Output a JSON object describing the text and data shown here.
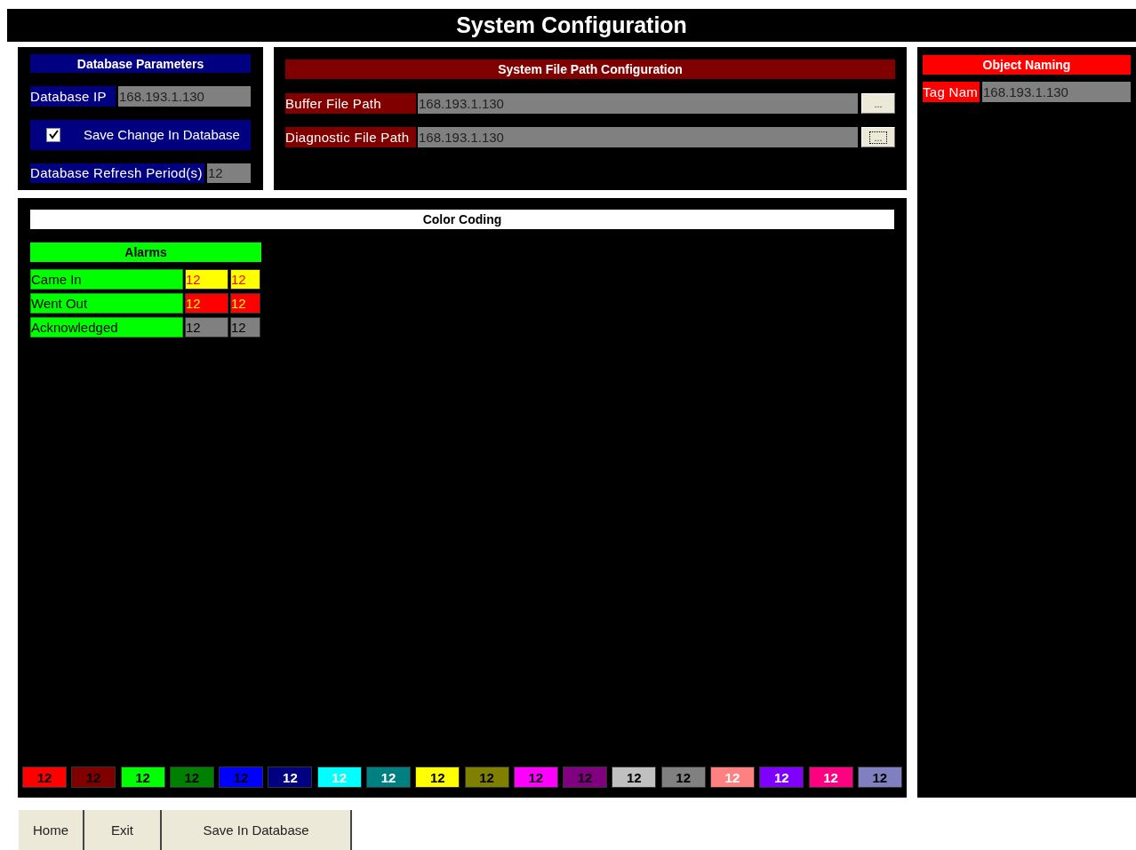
{
  "window": {
    "title": "System Configuration"
  },
  "database_parameters": {
    "title": "Database Parameters",
    "ip_label": "Database IP",
    "ip_value": "168.193.1.130",
    "save_change": {
      "label": "Save Change In Database",
      "checked": true
    },
    "refresh_label": "Database Refresh Period(s)",
    "refresh_value": "12"
  },
  "file_paths": {
    "title": "System File Path Configuration",
    "rows": [
      {
        "label": "Buffer File Path",
        "value": "168.193.1.130",
        "button": "...",
        "focused": false
      },
      {
        "label": "Diagnostic File Path",
        "value": "168.193.1.130",
        "button": "...",
        "focused": true
      }
    ]
  },
  "object_naming": {
    "title": "Object Naming",
    "label": "Tag Nam",
    "value": "168.193.1.130"
  },
  "color_coding": {
    "title": "Color Coding",
    "alarms": {
      "title": "Alarms",
      "rows": [
        {
          "label": "Came In",
          "cells": [
            {
              "text": "12",
              "color": "#ffff00",
              "kind": "red"
            },
            {
              "text": "12",
              "color": "#ffff00",
              "kind": "red"
            }
          ]
        },
        {
          "label": "Went Out",
          "cells": [
            {
              "text": "12",
              "color": "#ff0000",
              "kind": "yellow"
            },
            {
              "text": "12",
              "color": "#ff0000",
              "kind": "yellow"
            }
          ]
        },
        {
          "label": "Acknowledged",
          "cells": [
            {
              "text": "12",
              "color": "#808080",
              "kind": "dark"
            },
            {
              "text": "12",
              "color": "#808080",
              "kind": "dark"
            }
          ]
        }
      ]
    },
    "palette": [
      {
        "text": "12",
        "color": "#ff0000",
        "kind": "dark"
      },
      {
        "text": "12",
        "color": "#800000",
        "kind": "dark"
      },
      {
        "text": "12",
        "color": "#00ff00",
        "kind": "dark"
      },
      {
        "text": "12",
        "color": "#008000",
        "kind": "dark"
      },
      {
        "text": "12",
        "color": "#0000ff",
        "kind": "dark"
      },
      {
        "text": "12",
        "color": "#000080",
        "kind": "light"
      },
      {
        "text": "12",
        "color": "#00ffff",
        "kind": "light"
      },
      {
        "text": "12",
        "color": "#008080",
        "kind": "light"
      },
      {
        "text": "12",
        "color": "#ffff00",
        "kind": "dark"
      },
      {
        "text": "12",
        "color": "#808000",
        "kind": "dark"
      },
      {
        "text": "12",
        "color": "#ff00ff",
        "kind": "dark"
      },
      {
        "text": "12",
        "color": "#800080",
        "kind": "dark"
      },
      {
        "text": "12",
        "color": "#c0c0c0",
        "kind": "dark"
      },
      {
        "text": "12",
        "color": "#808080",
        "kind": "dark"
      },
      {
        "text": "12",
        "color": "#ff8080",
        "kind": "light"
      },
      {
        "text": "12",
        "color": "#8000ff",
        "kind": "light"
      },
      {
        "text": "12",
        "color": "#ff0080",
        "kind": "light"
      },
      {
        "text": "12",
        "color": "#8080c0",
        "kind": "dark"
      }
    ]
  },
  "buttons": [
    "Home",
    "Exit",
    "Save In Database"
  ]
}
